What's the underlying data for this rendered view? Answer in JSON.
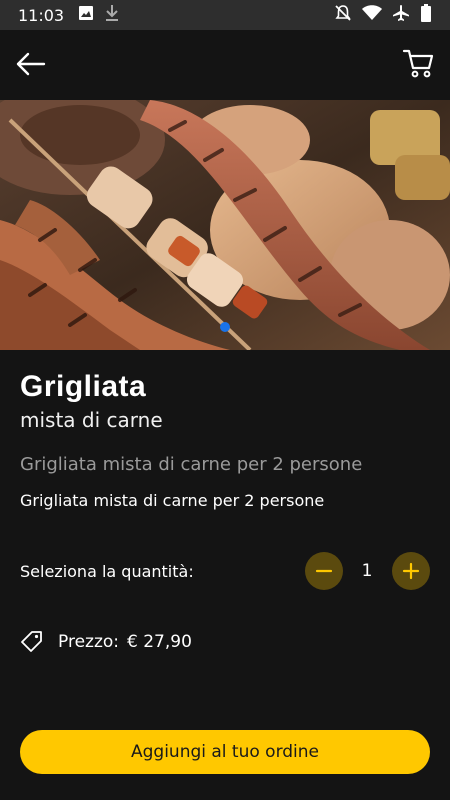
{
  "status_bar": {
    "time": "11:03",
    "icons": [
      "image-icon",
      "download-icon",
      "notifications-off-icon",
      "wifi-icon",
      "airplane-icon",
      "battery-icon"
    ]
  },
  "app_bar": {
    "back_icon": "arrow-left-icon",
    "cart_icon": "cart-icon"
  },
  "carousel": {
    "image_subject": "grilled mixed meats",
    "page_indicator_color": "#1a73e8"
  },
  "product": {
    "title": "Grigliata",
    "subtitle": "mista di carne",
    "description_muted": "Grigliata mista di carne per 2 persone",
    "description": "Grigliata mista di carne per 2 persone"
  },
  "quantity": {
    "label": "Seleziona la quantità:",
    "value": "1"
  },
  "price": {
    "label": "Prezzo:",
    "value": "€ 27,90"
  },
  "order_button": {
    "label": "Aggiungi al tuo ordine"
  },
  "colors": {
    "accent": "#ffc800",
    "stepper_bg": "#5b4a0e",
    "background": "#141414"
  }
}
